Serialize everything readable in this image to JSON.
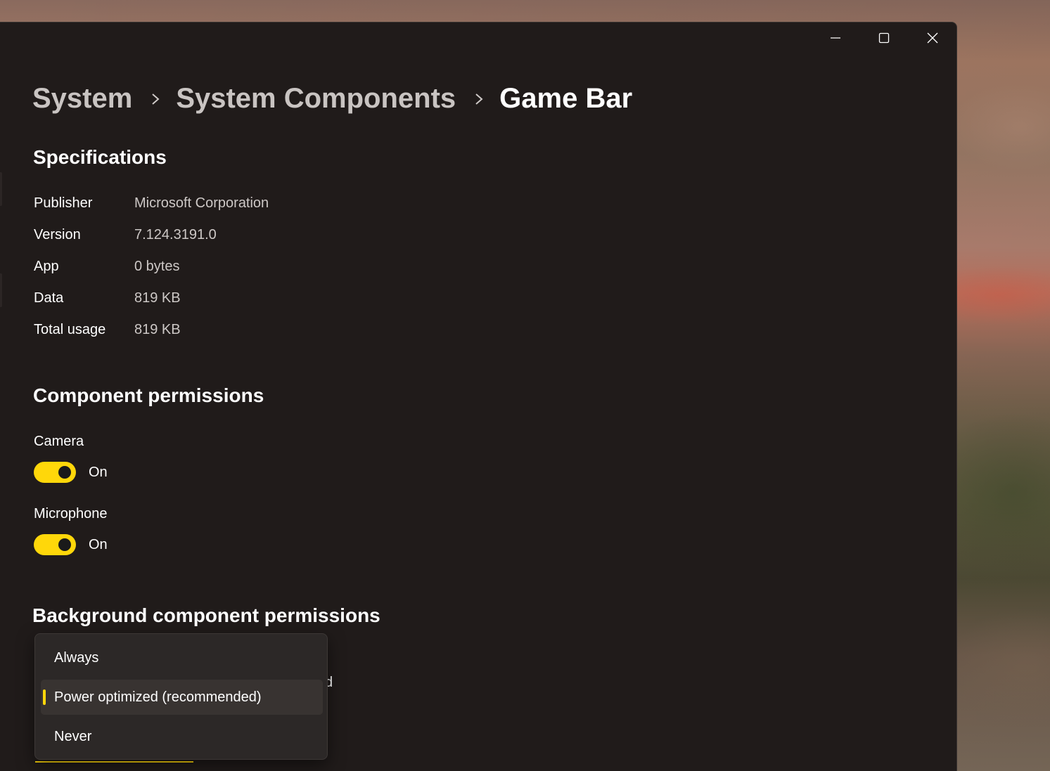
{
  "window": {
    "caption": {
      "minimize_icon": "minimize-icon",
      "maximize_icon": "maximize-icon",
      "close_icon": "close-icon"
    }
  },
  "breadcrumb": {
    "items": [
      "System",
      "System Components",
      "Game Bar"
    ],
    "separator_icon": "chevron-right-icon"
  },
  "specifications": {
    "title": "Specifications",
    "rows": [
      {
        "label": "Publisher",
        "value": "Microsoft Corporation"
      },
      {
        "label": "Version",
        "value": "7.124.3191.0"
      },
      {
        "label": "App",
        "value": "0 bytes"
      },
      {
        "label": "Data",
        "value": "819 KB"
      },
      {
        "label": "Total usage",
        "value": "819 KB"
      }
    ]
  },
  "component_permissions": {
    "title": "Component permissions",
    "items": [
      {
        "label": "Camera",
        "state": "On",
        "enabled": true
      },
      {
        "label": "Microphone",
        "state": "On",
        "enabled": true
      }
    ]
  },
  "background_permissions": {
    "title": "Background component permissions",
    "partial_text": "d",
    "dropdown": {
      "options": [
        "Always",
        "Power optimized (recommended)",
        "Never"
      ],
      "selected": "Power optimized (recommended)"
    }
  },
  "colors": {
    "accent": "#ffd70a",
    "window_bg": "#201b1a",
    "text_primary": "#ffffff",
    "text_secondary": "#cdc8c6"
  }
}
